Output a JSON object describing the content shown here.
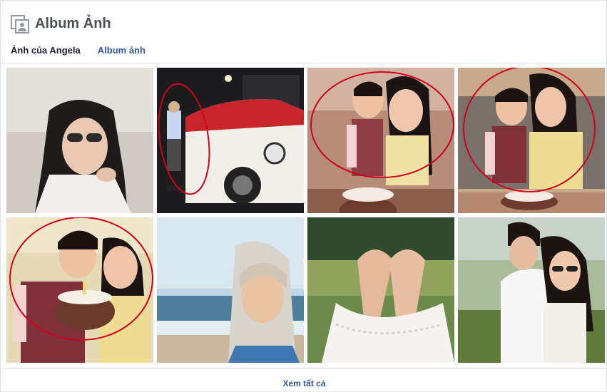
{
  "header": {
    "title": "Album Ảnh",
    "icon": "photo-album-icon"
  },
  "tabs": [
    {
      "label": "Ảnh của Angela",
      "active": true
    },
    {
      "label": "Album ảnh",
      "active": false
    }
  ],
  "footer": {
    "see_all": "Xem tất cả"
  },
  "colors": {
    "link": "#365899",
    "annotation": "#d0021b",
    "border": "#dddfe2"
  }
}
